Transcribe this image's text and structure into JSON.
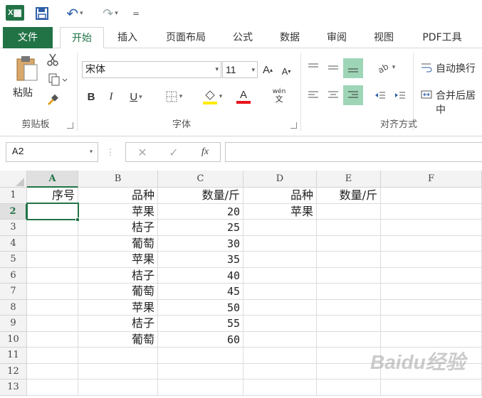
{
  "qat": {
    "logo_letter": "X",
    "undo_symbol": "↶",
    "redo_symbol": "↷",
    "more_symbol": "="
  },
  "tabs": [
    {
      "label": "文件"
    },
    {
      "label": "开始"
    },
    {
      "label": "插入"
    },
    {
      "label": "页面布局"
    },
    {
      "label": "公式"
    },
    {
      "label": "数据"
    },
    {
      "label": "审阅"
    },
    {
      "label": "视图"
    },
    {
      "label": "PDF工具"
    }
  ],
  "ribbon": {
    "clipboard": {
      "paste_label": "粘贴",
      "group_label": "剪贴板"
    },
    "font": {
      "font_name": "宋体",
      "font_size": "11",
      "grow_label": "A",
      "shrink_label": "A",
      "bold_label": "B",
      "italic_label": "I",
      "underline_label": "U",
      "font_color_label": "A",
      "phonetic_top": "wén",
      "phonetic_bottom": "文",
      "group_label": "字体"
    },
    "alignment": {
      "wrap_text_label": "自动换行",
      "merge_center_label": "合并后居中",
      "group_label": "对齐方式"
    }
  },
  "formula_bar": {
    "name_box": "A2",
    "cancel_symbol": "✕",
    "enter_symbol": "✓",
    "fx_label": "fx",
    "formula": ""
  },
  "sheet": {
    "columns": [
      "A",
      "B",
      "C",
      "D",
      "E",
      "F"
    ],
    "row_numbers": [
      "1",
      "2",
      "3",
      "4",
      "5",
      "6",
      "7",
      "8",
      "9",
      "10",
      "11",
      "12",
      "13"
    ],
    "rows": [
      [
        "序号",
        "品种",
        "数量/斤",
        "品种",
        "数量/斤",
        ""
      ],
      [
        "",
        "苹果",
        "20",
        "苹果",
        "",
        ""
      ],
      [
        "",
        "桔子",
        "25",
        "",
        "",
        ""
      ],
      [
        "",
        "葡萄",
        "30",
        "",
        "",
        ""
      ],
      [
        "",
        "苹果",
        "35",
        "",
        "",
        ""
      ],
      [
        "",
        "桔子",
        "40",
        "",
        "",
        ""
      ],
      [
        "",
        "葡萄",
        "45",
        "",
        "",
        ""
      ],
      [
        "",
        "苹果",
        "50",
        "",
        "",
        ""
      ],
      [
        "",
        "桔子",
        "55",
        "",
        "",
        ""
      ],
      [
        "",
        "葡萄",
        "60",
        "",
        "",
        ""
      ],
      [
        "",
        "",
        "",
        "",
        "",
        ""
      ],
      [
        "",
        "",
        "",
        "",
        "",
        ""
      ],
      [
        "",
        "",
        "",
        "",
        "",
        ""
      ]
    ],
    "active_cell": "A2"
  },
  "watermark": "Baidu经验",
  "colors": {
    "accent": "#217346",
    "highlight": "#9fd5b7",
    "font_color_bar": "#e8141b",
    "fill_color_bar": "#ffeb00"
  }
}
